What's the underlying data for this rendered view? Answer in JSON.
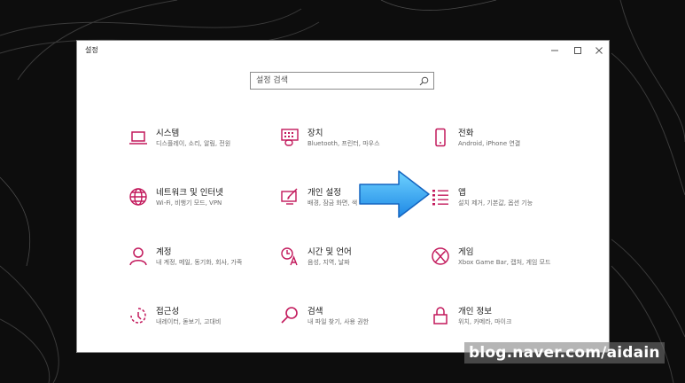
{
  "window": {
    "title": "설정",
    "controls": [
      "minimize-icon",
      "maximize-icon",
      "close-icon"
    ]
  },
  "search": {
    "placeholder": "설정 검색",
    "icon": "search-icon"
  },
  "accent_color": "#c2185b",
  "tiles": [
    {
      "title": "시스템",
      "desc": "디스플레이, 소리, 알림, 전원",
      "icon": "laptop-icon"
    },
    {
      "title": "장치",
      "desc": "Bluetooth, 프린터, 마우스",
      "icon": "keyboard-devices-icon"
    },
    {
      "title": "전화",
      "desc": "Android, iPhone 연결",
      "icon": "phone-icon"
    },
    {
      "title": "네트워크 및 인터넷",
      "desc": "Wi-Fi, 비행기 모드, VPN",
      "icon": "globe-icon"
    },
    {
      "title": "개인 설정",
      "desc": "배경, 잠금 화면, 색",
      "icon": "personalization-icon"
    },
    {
      "title": "앱",
      "desc": "설치 제거, 기본값, 옵션 기능",
      "icon": "apps-list-icon"
    },
    {
      "title": "계정",
      "desc": "내 계정, 메일, 동기화, 회사, 가족",
      "icon": "person-icon"
    },
    {
      "title": "시간 및 언어",
      "desc": "음성, 지역, 날짜",
      "icon": "time-language-icon"
    },
    {
      "title": "게임",
      "desc": "Xbox Game Bar, 캡처, 게임 모드",
      "icon": "xbox-icon"
    },
    {
      "title": "접근성",
      "desc": "내레이터, 돋보기, 고대비",
      "icon": "ease-of-access-icon"
    },
    {
      "title": "검색",
      "desc": "내 파일 찾기, 사용 권한",
      "icon": "search-magnifier-icon"
    },
    {
      "title": "개인 정보",
      "desc": "위치, 카메라, 마이크",
      "icon": "lock-icon"
    }
  ],
  "annotation": {
    "icon": "blue-arrow-icon"
  },
  "watermark": "blog.naver.com/aidain"
}
